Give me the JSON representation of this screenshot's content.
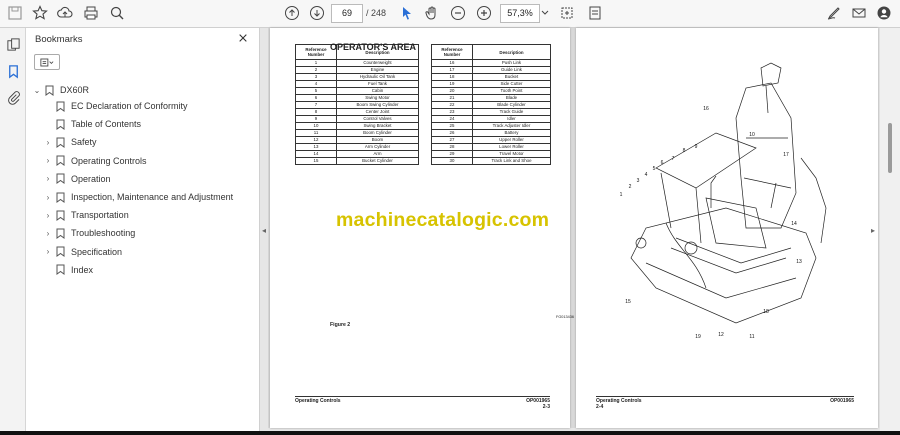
{
  "toolbar": {
    "page_current": "69",
    "page_total": "/ 248",
    "zoom": "57,3%"
  },
  "bookmarks": {
    "title": "Bookmarks",
    "root": "DX60R",
    "items": [
      {
        "label": "EC Declaration of Conformity",
        "expandable": false
      },
      {
        "label": "Table of Contents",
        "expandable": false
      },
      {
        "label": "Safety",
        "expandable": true
      },
      {
        "label": "Operating Controls",
        "expandable": true
      },
      {
        "label": "Operation",
        "expandable": true
      },
      {
        "label": "Inspection, Maintenance and Adjustment",
        "expandable": true
      },
      {
        "label": "Transportation",
        "expandable": true
      },
      {
        "label": "Troubleshooting",
        "expandable": true
      },
      {
        "label": "Specification",
        "expandable": true
      },
      {
        "label": "Index",
        "expandable": false
      }
    ]
  },
  "page_left": {
    "table_header": {
      "ref": "Reference Number",
      "desc": "Description"
    },
    "table1": [
      [
        "1",
        "Counterweight"
      ],
      [
        "2",
        "Engine"
      ],
      [
        "3",
        "Hydraulic Oil Tank"
      ],
      [
        "4",
        "Fuel Tank"
      ],
      [
        "5",
        "Cabin"
      ],
      [
        "6",
        "Swing Motor"
      ],
      [
        "7",
        "Boom Swing Cylinder"
      ],
      [
        "8",
        "Center Joint"
      ],
      [
        "9",
        "Control Valves"
      ],
      [
        "10",
        "Swing Bracket"
      ],
      [
        "11",
        "Boom Cylinder"
      ],
      [
        "12",
        "Boom"
      ],
      [
        "13",
        "Arm Cylinder"
      ],
      [
        "14",
        "Arm"
      ],
      [
        "15",
        "Bucket Cylinder"
      ]
    ],
    "table2": [
      [
        "16",
        "Push Link"
      ],
      [
        "17",
        "Guide Link"
      ],
      [
        "18",
        "Bucket"
      ],
      [
        "19",
        "Side Cutter"
      ],
      [
        "20",
        "Tooth Point"
      ],
      [
        "21",
        "Blade"
      ],
      [
        "22",
        "Blade Cylinder"
      ],
      [
        "23",
        "Track Guide"
      ],
      [
        "24",
        "Idler"
      ],
      [
        "25",
        "Track Adjuster Idler"
      ],
      [
        "26",
        "Battery"
      ],
      [
        "27",
        "Upper Roller"
      ],
      [
        "28",
        "Lower Roller"
      ],
      [
        "29",
        "Travel Motor"
      ],
      [
        "30",
        "Track Link and Shoe"
      ]
    ],
    "footer_left": "Operating Controls",
    "footer_right": "OP001965",
    "page_no": "2-3"
  },
  "page_right": {
    "title": "OPERATOR'S AREA",
    "figure_label": "Figure 2",
    "figure_code": "FG013436",
    "callouts": [
      "1",
      "2",
      "3",
      "4",
      "5",
      "6",
      "7",
      "8",
      "9",
      "10",
      "11",
      "12",
      "13",
      "14",
      "15",
      "16",
      "17",
      "18",
      "19"
    ],
    "footer_left": "Operating Controls",
    "footer_right": "OP001965",
    "page_no": "2-4"
  },
  "watermark": "machinecatalogic.com",
  "colors": {
    "watermark": "#d7c300",
    "toolbar_bg": "#f7f7f7"
  }
}
